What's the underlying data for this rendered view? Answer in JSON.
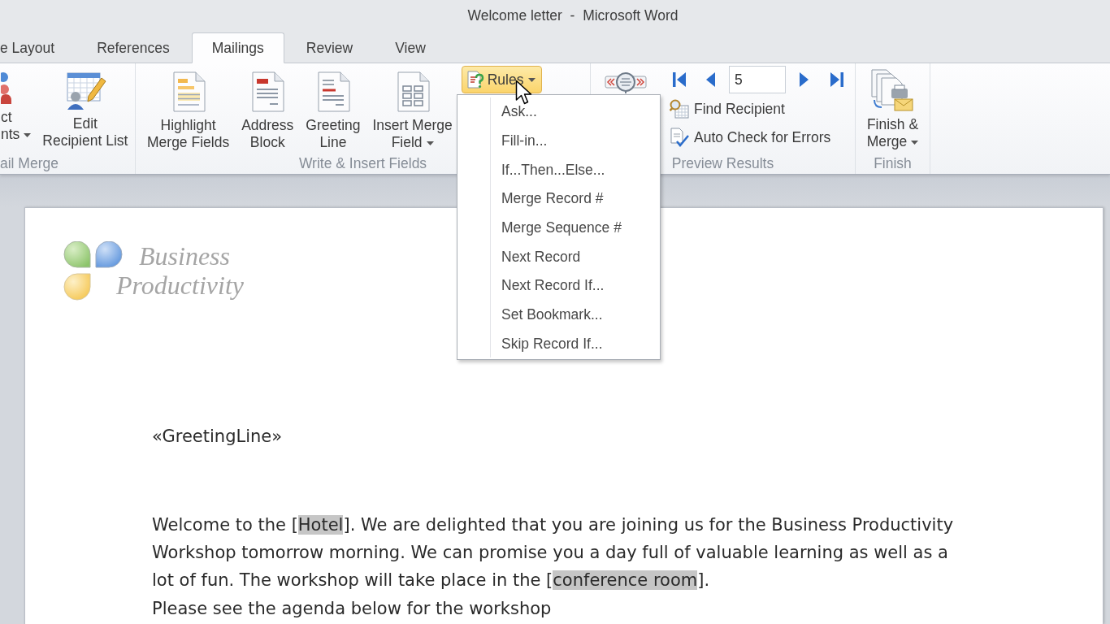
{
  "window": {
    "title": "Welcome letter  -  Microsoft Word"
  },
  "tabs": [
    {
      "label": "e Layout",
      "selected": false
    },
    {
      "label": "References",
      "selected": false
    },
    {
      "label": "Mailings",
      "selected": true
    },
    {
      "label": "Review",
      "selected": false
    },
    {
      "label": "View",
      "selected": false
    }
  ],
  "ribbon": {
    "mail_merge": {
      "label": "ail Merge",
      "buttons": [
        {
          "label": "ct\nnts",
          "dropdown": true
        },
        {
          "label": "Edit\nRecipient List",
          "dropdown": false
        }
      ]
    },
    "write_insert": {
      "label": "Write & Insert Fields",
      "buttons": [
        {
          "label": "Highlight\nMerge Fields",
          "dropdown": false
        },
        {
          "label": "Address\nBlock",
          "dropdown": false
        },
        {
          "label": "Greeting\nLine",
          "dropdown": false
        },
        {
          "label": "Insert Merge\nField",
          "dropdown": true
        }
      ],
      "rules": {
        "label": "Rules",
        "dropdown": true,
        "expanded": true
      }
    },
    "preview": {
      "label": "Preview Results",
      "record": {
        "value": "5"
      },
      "buttons": [
        {
          "label": "Find Recipient"
        },
        {
          "label": "Auto Check for Errors"
        }
      ]
    },
    "finish": {
      "label": "Finish",
      "buttons": [
        {
          "label": "Finish &\nMerge",
          "dropdown": true
        }
      ]
    }
  },
  "rules_menu": {
    "items": [
      {
        "label": "Ask..."
      },
      {
        "label": "Fill-in..."
      },
      {
        "label": "If...Then...Else..."
      },
      {
        "label": "Merge Record #"
      },
      {
        "label": "Merge Sequence #"
      },
      {
        "label": "Next Record"
      },
      {
        "label": "Next Record If..."
      },
      {
        "label": "Set Bookmark..."
      },
      {
        "label": "Skip Record If..."
      }
    ]
  },
  "document": {
    "logo": {
      "lines": [
        "Business",
        "Productivity"
      ]
    },
    "greeting": "«GreetingLine»",
    "paragraphs": [
      {
        "runs": [
          {
            "text": "Welcome to the [",
            "shaded": false
          },
          {
            "text": "Hotel",
            "shaded": true
          },
          {
            "text": "]. We are delighted that you are joining us for the Business Productivity Workshop tomorrow morning. We can promise you a day full of valuable learning as well as a lot of fun. The workshop will take place in the [",
            "shaded": false
          },
          {
            "text": "conference room",
            "shaded": true
          },
          {
            "text": "].",
            "shaded": false
          }
        ]
      },
      {
        "runs": [
          {
            "text": "Please see the agenda below for the workshop",
            "shaded": false
          }
        ]
      }
    ]
  }
}
